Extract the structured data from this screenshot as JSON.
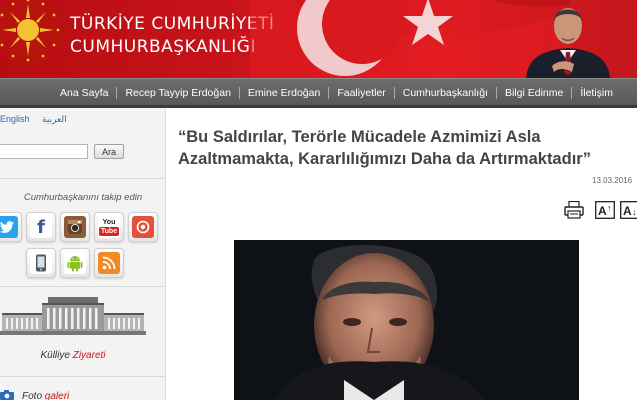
{
  "header": {
    "title_line1": "TÜRKİYE CUMHURİYETİ",
    "title_line2": "CUMHURBAŞKANLIĞI"
  },
  "nav": {
    "items": [
      "Ana Sayfa",
      "Recep Tayyip Erdoğan",
      "Emine Erdoğan",
      "Faaliyetler",
      "Cumhurbaşkanlığı",
      "Bilgi Edinme",
      "İletişim"
    ]
  },
  "sidebar": {
    "lang_en": "English",
    "lang_ar": "العربية",
    "search_placeholder": "",
    "search_button": "Ara",
    "follow_text": "Cumhurbaşkanını takip edin",
    "social_icons": [
      "twitter-icon",
      "facebook-icon",
      "instagram-icon",
      "youtube-icon",
      "periscope-icon",
      "mobile-app-icon",
      "android-icon",
      "rss-icon"
    ],
    "kulliye_label": "Külliye",
    "kulliye_link": "Ziyareti",
    "foto_label": "Foto",
    "foto_link": "galeri"
  },
  "article": {
    "headline_line1": "“Bu Saldırılar, Terörle Mücadele Azmimizi Asla",
    "headline_line2": "Azaltmamakta, Kararlılığımızı Daha da Artırmaktadır”",
    "date": "13.03.2016",
    "tools": [
      "print-icon",
      "font-increase-icon",
      "font-decrease-icon"
    ]
  },
  "colors": {
    "header_red": "#c9141a",
    "nav_gray": "#5f5f5f",
    "link_blue": "#2a6ab8",
    "accent_red": "#c4161c"
  }
}
